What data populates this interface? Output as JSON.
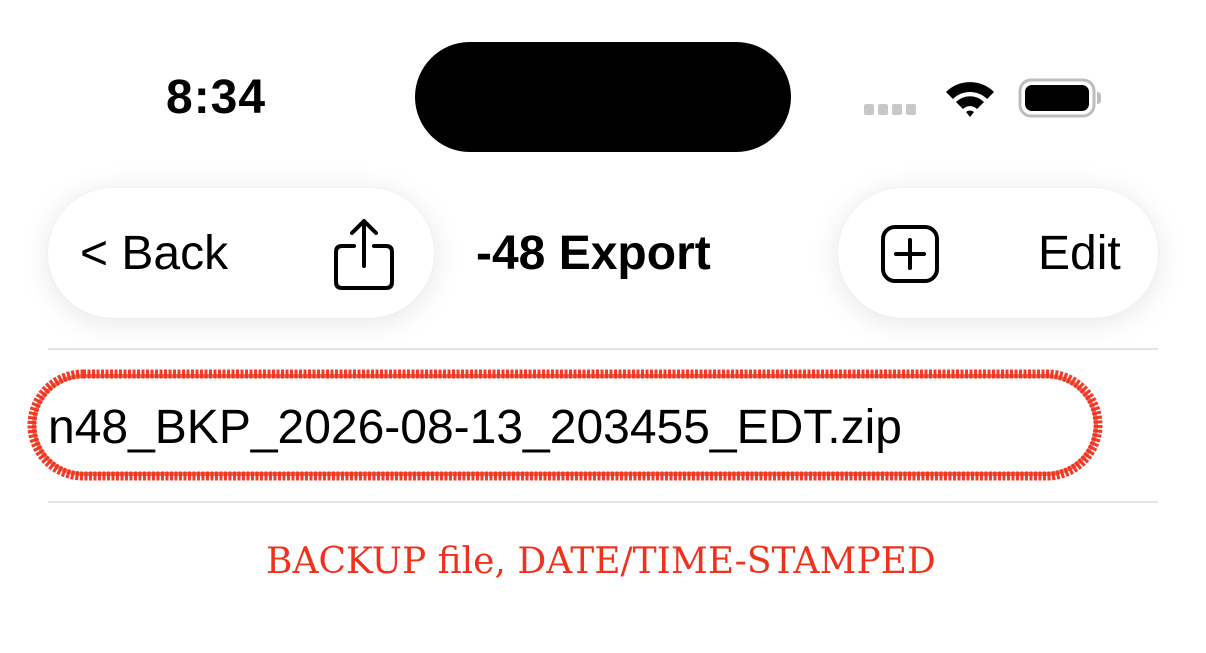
{
  "status_bar": {
    "time": "8:34"
  },
  "nav": {
    "back_label": "< Back",
    "title": "-48 Export",
    "edit_label": "Edit",
    "icons": {
      "share": "share-icon",
      "add": "add-square-icon"
    }
  },
  "files": [
    {
      "name": "n48_BKP_2026-08-13_203455_EDT.zip"
    }
  ],
  "annotation": {
    "text": "BACKUP file, DATE/TIME-STAMPED",
    "color": "#f0321c"
  }
}
